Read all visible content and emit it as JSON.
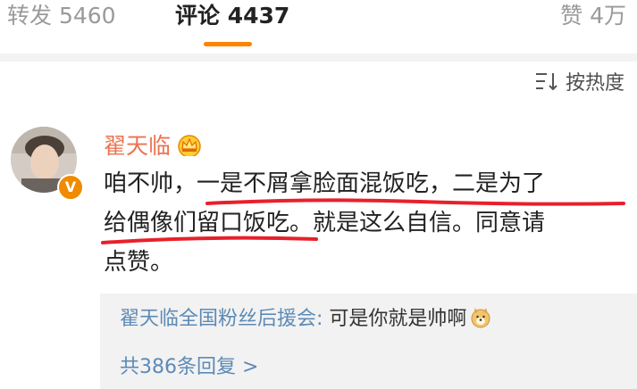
{
  "tabs": {
    "repost": "转发 5460",
    "comment": "评论 4437",
    "like": "赞 4万"
  },
  "sort_label": "按热度",
  "comment": {
    "author": "翟天临",
    "lines": [
      "咱不帅，一是不屑拿脸面混饭吃，二是为了",
      "给偶像们留口饭吃。就是这么自信。同意请",
      "点赞。"
    ]
  },
  "reply": {
    "author": "翟天临全国粉丝后援会",
    "separator": ": ",
    "text": "可是你就是帅啊",
    "count": "共386条回复 >"
  },
  "colors": {
    "accent": "#ff8200",
    "author_name": "#eb7350",
    "link_blue": "#5d8ab6",
    "underline_red": "#e8202a"
  }
}
